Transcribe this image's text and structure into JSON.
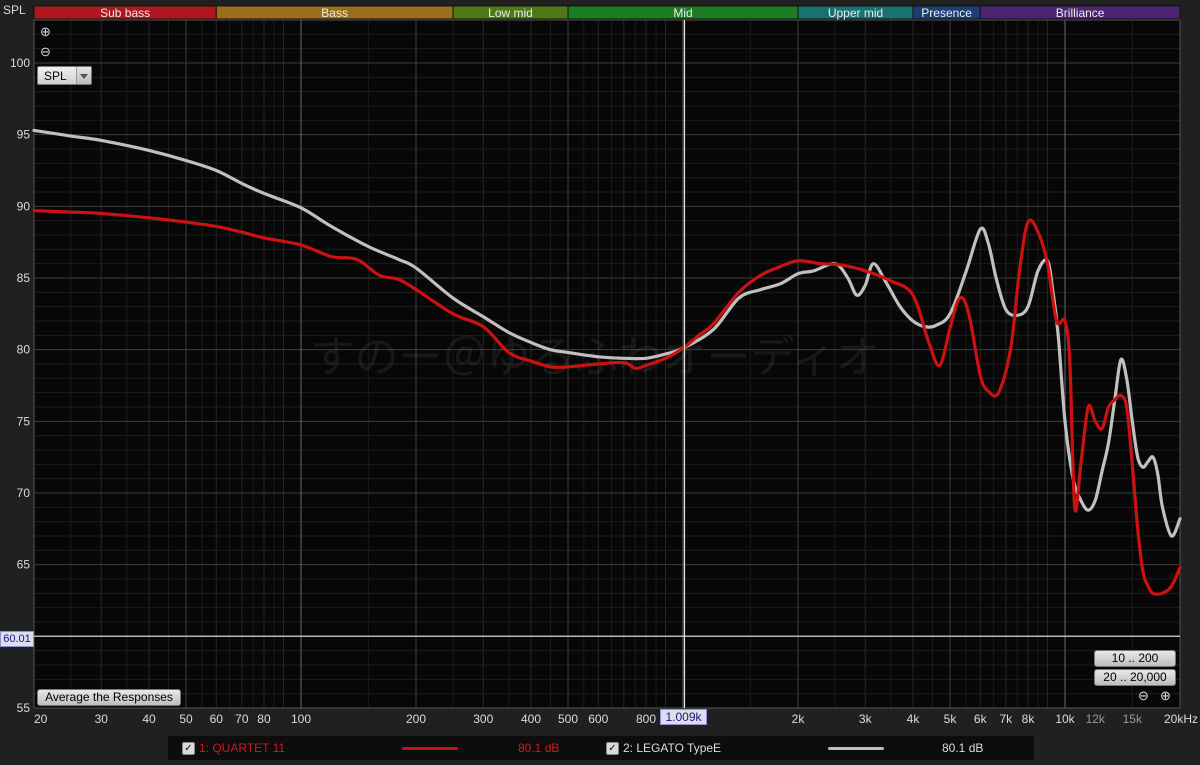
{
  "bands": [
    {
      "label": "Sub bass",
      "from": 20,
      "to": 60,
      "color": "#b0161f"
    },
    {
      "label": "Bass",
      "from": 60,
      "to": 250,
      "color": "#9a6f1b"
    },
    {
      "label": "Low mid",
      "from": 250,
      "to": 500,
      "color": "#4e7a16"
    },
    {
      "label": "Mid",
      "from": 500,
      "to": 2000,
      "color": "#1c7d24"
    },
    {
      "label": "Upper mid",
      "from": 2000,
      "to": 4000,
      "color": "#187271"
    },
    {
      "label": "Presence",
      "from": 4000,
      "to": 6000,
      "color": "#1b3f72"
    },
    {
      "label": "Brilliance",
      "from": 6000,
      "to": 20000,
      "color": "#4b2473"
    }
  ],
  "controls": {
    "zoom_in_label": "⊕",
    "zoom_out_label": "⊖",
    "unit_select": "SPL",
    "unit_corner": "SPL",
    "average_button": "Average the Responses",
    "range_button_1": "10 .. 200",
    "range_button_2": "20 .. 20,000",
    "cursor_freq": "1.009k",
    "cursor_spl": "60.01",
    "bottom_zoom_out": "⊖",
    "bottom_zoom_in": "⊕"
  },
  "watermark": "すのー＠ゆるふわオーディオ",
  "legend": [
    {
      "check": "✓",
      "label": "1: QUARTET 11",
      "value": "80.1 dB",
      "color": "#cc1111"
    },
    {
      "check": "✓",
      "label": "2: LEGATO TypeE",
      "value": "80.1 dB",
      "color": "#bdbdbd"
    }
  ],
  "chart_data": {
    "type": "line",
    "xscale": "log",
    "xlim": [
      20,
      20000
    ],
    "ylim": [
      55,
      103
    ],
    "xticks": [
      {
        "v": 20,
        "t": "20"
      },
      {
        "v": 30,
        "t": "30"
      },
      {
        "v": 40,
        "t": "40"
      },
      {
        "v": 50,
        "t": "50"
      },
      {
        "v": 60,
        "t": "60"
      },
      {
        "v": 70,
        "t": "70"
      },
      {
        "v": 80,
        "t": "80"
      },
      {
        "v": 100,
        "t": "100"
      },
      {
        "v": 200,
        "t": "200"
      },
      {
        "v": 300,
        "t": "300"
      },
      {
        "v": 400,
        "t": "400"
      },
      {
        "v": 500,
        "t": "500"
      },
      {
        "v": 600,
        "t": "600"
      },
      {
        "v": 800,
        "t": "800"
      },
      {
        "v": 2000,
        "t": "2k"
      },
      {
        "v": 3000,
        "t": "3k"
      },
      {
        "v": 4000,
        "t": "4k"
      },
      {
        "v": 5000,
        "t": "5k"
      },
      {
        "v": 6000,
        "t": "6k"
      },
      {
        "v": 7000,
        "t": "7k"
      },
      {
        "v": 8000,
        "t": "8k"
      },
      {
        "v": 10000,
        "t": "10k"
      },
      {
        "v": 12000,
        "t": "12k",
        "dim": true
      },
      {
        "v": 15000,
        "t": "15k",
        "dim": true
      },
      {
        "v": 20000,
        "t": "20kHz"
      }
    ],
    "yticks": [
      55,
      60,
      65,
      70,
      75,
      80,
      85,
      90,
      95,
      100
    ],
    "cursor_x": 1009,
    "cursor_y": 60.01,
    "series": [
      {
        "name": "1: QUARTET 11",
        "color": "#cc1111",
        "x": [
          20,
          25,
          30,
          40,
          50,
          60,
          70,
          80,
          100,
          120,
          140,
          160,
          180,
          200,
          250,
          300,
          350,
          400,
          450,
          500,
          600,
          700,
          750,
          800,
          900,
          1000,
          1100,
          1200,
          1400,
          1600,
          1800,
          2000,
          2300,
          2600,
          3000,
          3500,
          4000,
          4400,
          4700,
          5000,
          5300,
          5600,
          6000,
          6300,
          6700,
          7200,
          7600,
          8000,
          8500,
          9000,
          9500,
          10000,
          10300,
          10600,
          11000,
          11500,
          12000,
          12500,
          13000,
          13500,
          14000,
          14500,
          15000,
          15500,
          16000,
          16500,
          17000,
          18000,
          19000,
          20000
        ],
        "y": [
          89.7,
          89.6,
          89.5,
          89.2,
          88.9,
          88.6,
          88.2,
          87.8,
          87.3,
          86.5,
          86.3,
          85.2,
          84.9,
          84.2,
          82.5,
          81.6,
          79.8,
          79.2,
          78.8,
          78.8,
          79.0,
          79.1,
          78.7,
          78.9,
          79.4,
          80.1,
          81.0,
          81.8,
          84.0,
          85.2,
          85.8,
          86.2,
          86.0,
          85.9,
          85.5,
          84.8,
          83.8,
          80.5,
          78.9,
          81.5,
          83.6,
          82.5,
          78.2,
          77.1,
          77.0,
          80.0,
          85.5,
          88.9,
          88.2,
          86.0,
          82.0,
          82.0,
          79.0,
          69.0,
          72.0,
          76.0,
          75.0,
          74.5,
          76.0,
          76.5,
          76.8,
          76.0,
          72.0,
          67.5,
          64.5,
          63.5,
          63.0,
          63.0,
          63.5,
          64.8
        ]
      },
      {
        "name": "2: LEGATO TypeE",
        "color": "#c0c0c0",
        "x": [
          20,
          25,
          30,
          40,
          50,
          60,
          70,
          80,
          100,
          120,
          150,
          180,
          200,
          250,
          300,
          350,
          400,
          450,
          500,
          600,
          700,
          800,
          900,
          1000,
          1200,
          1400,
          1600,
          1800,
          2000,
          2200,
          2500,
          2700,
          2850,
          3000,
          3150,
          3400,
          3700,
          4000,
          4300,
          4600,
          5000,
          5500,
          6000,
          6300,
          6600,
          7000,
          7500,
          8000,
          8500,
          9000,
          9300,
          9600,
          10000,
          10500,
          11000,
          11500,
          12000,
          12500,
          13000,
          13500,
          14000,
          14500,
          15000,
          15500,
          16000,
          16500,
          17000,
          17500,
          18000,
          19000,
          20000
        ],
        "y": [
          95.3,
          94.9,
          94.6,
          93.9,
          93.2,
          92.5,
          91.6,
          90.9,
          89.9,
          88.6,
          87.2,
          86.3,
          85.7,
          83.6,
          82.3,
          81.2,
          80.5,
          80.0,
          79.8,
          79.5,
          79.4,
          79.4,
          79.7,
          80.1,
          81.4,
          83.6,
          84.2,
          84.6,
          85.3,
          85.5,
          86.0,
          85.0,
          83.8,
          84.5,
          86.0,
          84.7,
          83.0,
          82.0,
          81.6,
          81.7,
          82.5,
          85.4,
          88.4,
          87.4,
          85.0,
          82.8,
          82.4,
          83.0,
          85.5,
          86.2,
          84.0,
          81.0,
          75.0,
          71.0,
          69.5,
          68.8,
          69.5,
          71.5,
          73.5,
          76.5,
          79.3,
          78.0,
          75.0,
          72.5,
          71.8,
          72.2,
          72.5,
          71.3,
          69.0,
          67.0,
          68.2
        ]
      }
    ]
  }
}
